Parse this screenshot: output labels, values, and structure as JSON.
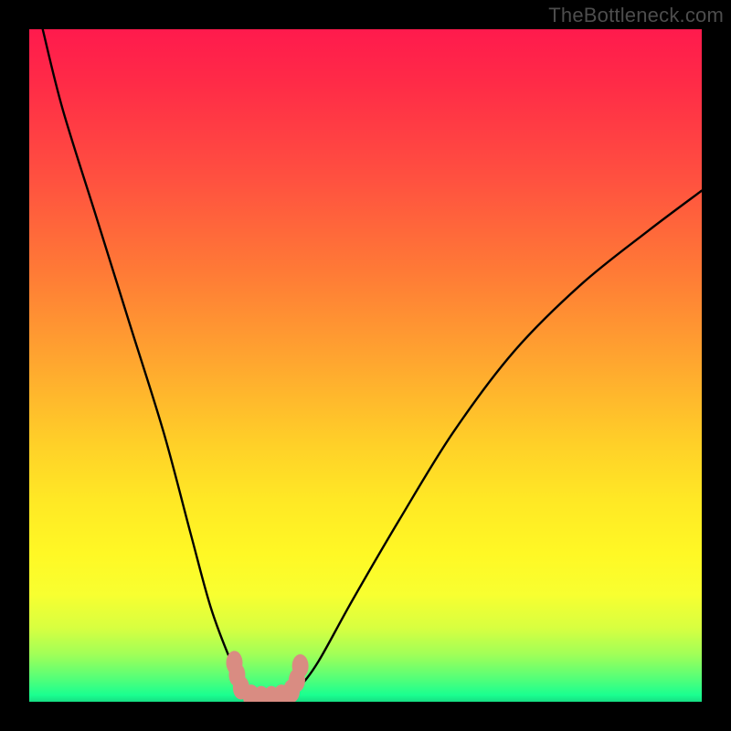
{
  "watermark": "TheBottleneck.com",
  "chart_data": {
    "type": "line",
    "title": "",
    "xlabel": "",
    "ylabel": "",
    "xlim": [
      0,
      100
    ],
    "ylim": [
      0,
      100
    ],
    "annotations": [],
    "series": [
      {
        "name": "bottleneck-curve",
        "x": [
          2,
          5,
          10,
          15,
          20,
          24,
          27,
          30,
          32,
          34,
          36,
          38,
          40,
          43,
          48,
          55,
          63,
          72,
          82,
          92,
          100
        ],
        "values": [
          100,
          88,
          72,
          56,
          40,
          25,
          14,
          6,
          2,
          0.5,
          0.5,
          0.5,
          2,
          6,
          15,
          27,
          40,
          52,
          62,
          70,
          76
        ]
      }
    ],
    "markers": {
      "name": "highlight-band",
      "color": "#d98c82",
      "points": [
        {
          "x": 30.5,
          "y": 5.8
        },
        {
          "x": 30.9,
          "y": 4.0
        },
        {
          "x": 31.5,
          "y": 2.1
        },
        {
          "x": 33.0,
          "y": 0.8
        },
        {
          "x": 34.5,
          "y": 0.6
        },
        {
          "x": 36.0,
          "y": 0.6
        },
        {
          "x": 37.5,
          "y": 0.8
        },
        {
          "x": 39.0,
          "y": 1.6
        },
        {
          "x": 39.8,
          "y": 3.2
        },
        {
          "x": 40.3,
          "y": 5.3
        }
      ]
    },
    "background_gradient": {
      "top": "#ff1a4d",
      "mid": "#ffe825",
      "bottom": "#17de83"
    }
  }
}
